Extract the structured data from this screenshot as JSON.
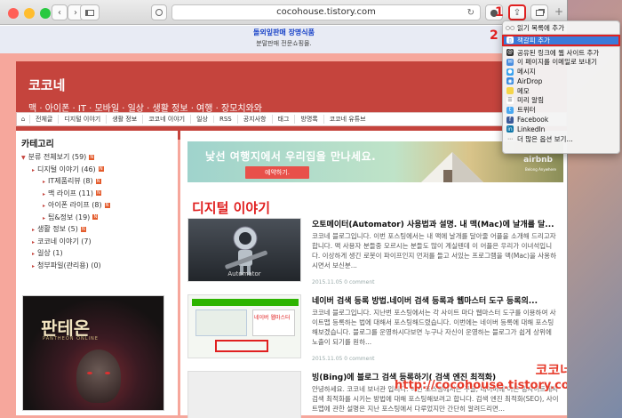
{
  "browser": {
    "url": "cocohouse.tistory.com",
    "toolbar_colors": {
      "close": "#ff5f57",
      "minimize": "#ffbd2e",
      "maximize": "#28c940"
    }
  },
  "top_ad": {
    "line1": "돌외잎판매 장명식품",
    "line2": "분말판매 전문쇼핑몰."
  },
  "blog": {
    "title": "코코네",
    "subtitle": "맥 · 아이폰 · IT · 모바일 · 일상 · 생활 정보 · 여행 · 장모치와와"
  },
  "nav": [
    "전체글",
    "디지털 이야기",
    "생활 정보",
    "코코네 이야기",
    "일상",
    "RSS",
    "공지사항",
    "태그",
    "방명록",
    "코코네 유튜브"
  ],
  "sidebar": {
    "heading": "카테고리",
    "items": [
      {
        "label": "분류 전체보기 (59)",
        "level": 0,
        "new": true
      },
      {
        "label": "디지털 이야기 (46)",
        "level": 1,
        "new": true
      },
      {
        "label": "IT제품리뷰 (8)",
        "level": 2,
        "new": true
      },
      {
        "label": "맥 라이프 (11)",
        "level": 2,
        "new": true
      },
      {
        "label": "아이폰 라이프 (8)",
        "level": 2,
        "new": true
      },
      {
        "label": "팁&정보 (19)",
        "level": 2,
        "new": true
      },
      {
        "label": "생활 정보 (5)",
        "level": 1,
        "new": true
      },
      {
        "label": "코코네 이야기 (7)",
        "level": 1,
        "new": false
      },
      {
        "label": "일상 (1)",
        "level": 1,
        "new": false
      },
      {
        "label": "청부파일(관리용) (0)",
        "level": 1,
        "new": false
      }
    ],
    "ad": {
      "logo": "판테온",
      "sub": "PANTHEON ONLINE"
    }
  },
  "banner": {
    "text": "낯선 여행지에서 우리집을 만나세요.",
    "button": "예약하기.",
    "brand": "airbnb",
    "brand_sub": "Belong Anywhere"
  },
  "main": {
    "page_title": "디지털 이야기",
    "posts": [
      {
        "title": "오토메이터(Automator) 사용법과 설명. 내 맥(Mac)에 날개를 달...",
        "desc": "코코네 블로그입니다. 이번 포스팅에서는 내 맥에 날개를 달아줄 어플을 소개해 드리고자 합니다. 맥 사용자 분들중 모르시는 분들도 많이 계실텐데 이 어플은 우리가 이녀석입니다. 이상하게 생긴 로봇이 파이프인지 먼저를 들고 서있는 프로그램을 맥(Mac)을 사용하시면서 보신분...",
        "meta": "2015.11.05  0 comment",
        "thumb_caption": "Automator"
      },
      {
        "title": "네이버 검색 등록 방법.네이버 검색 등록과 웹마스터 도구 등록의...",
        "desc": "코코네 블로그입니다. 지난번 포스팅에서는 각 사이트 마다 웹마스터 도구를 이용하여 사이트맵 등록하는 법에 대해서 포스팅해드렸습니다. 이번에는 네이버 등록에 대해 포스팅해보겠습니다. 블로그를 운영하시다보면 누구나 자신이 운영하는 블로그가 쉽게 상위에 노출이 되기를 원하...",
        "meta": "2015.11.05  0 comment",
        "thumb_caption": "네이버 웹마스터"
      },
      {
        "title": "빙(Bing)에 블로그 검색 등록하기( 검색 엔진 최적화)",
        "desc": "안녕하세요. 코코네 보너관 입니다. 이번 포스팅에서는 구글, 네이버에 이은 빙사이트에서 검색 최적화를 시키는 방법에 대해 포스팅해보려고 합니다. 검색 엔진 최적화(SEO), 사이트맵에 관한 설명은 지난 포스팅에서 다루었지만 간단히 알려드리면...",
        "meta": "",
        "thumb_caption": ""
      }
    ]
  },
  "share_menu": {
    "items": [
      {
        "label": "읽기 목록에 추가",
        "icon": "glasses-icon",
        "selected": false
      },
      {
        "label": "책갈피 추가",
        "icon": "book-icon",
        "selected": true
      },
      {
        "label": "공유된 링크에 웹 사이트 추가",
        "icon": "at-icon",
        "selected": false
      },
      {
        "label": "이 페이지를 이메일로 보내기",
        "icon": "mail-icon",
        "selected": false
      },
      {
        "label": "메시지",
        "icon": "messages-icon",
        "selected": false
      },
      {
        "label": "AirDrop",
        "icon": "airdrop-icon",
        "selected": false
      },
      {
        "label": "메모",
        "icon": "notes-icon",
        "selected": false
      },
      {
        "label": "미리 알림",
        "icon": "reminders-icon",
        "selected": false
      },
      {
        "label": "트위터",
        "icon": "twitter-icon",
        "selected": false
      },
      {
        "label": "Facebook",
        "icon": "facebook-icon",
        "selected": false
      },
      {
        "label": "LinkedIn",
        "icon": "linkedin-icon",
        "selected": false
      },
      {
        "label": "더 많은 옵션 보기...",
        "icon": "more-icon",
        "selected": false
      }
    ]
  },
  "annotations": {
    "step1": "1",
    "step2": "2",
    "watermark_name": "코코네",
    "watermark_url": "http://cocohouse.tistory.com"
  }
}
